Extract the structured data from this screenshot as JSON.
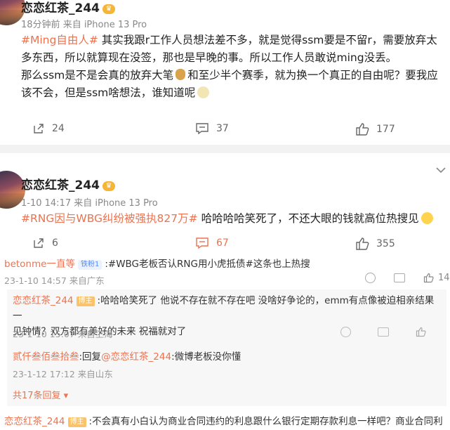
{
  "post1": {
    "username": "恋恋红茶_244",
    "time": "18分钟前",
    "source": "来自 iPhone 13 Pro",
    "topic": "#Ming自由人#",
    "text_line1": " 其实我跟r工作人员想法差不多，就是觉得ssm要是不留r，需要放弃太",
    "text_line2": "多东西，所以就算现在没签，那也是早晚的事。所以工作人员敢说ming没丢。",
    "text_line3a": "那么ssm是不是会真的放弃大笔",
    "text_line3b": "和至少半个赛季，就为换一个真正的自由呢？要我应",
    "text_line4": "该不会，但是ssm啥想法，谁知道呢",
    "share_count": "24",
    "comment_count": "37",
    "like_count": "177"
  },
  "post2": {
    "username": "恋恋红茶_244",
    "time": "1-10 14:17",
    "source": "来自 iPhone 13 Pro",
    "topic": "#RNG因与WBG纠纷被强执827万#",
    "text": " 哈哈哈哈笑死了，不还大眼的钱就高位热搜见",
    "share_count": "6",
    "comment_count": "67",
    "like_count": "355"
  },
  "comment1": {
    "user": "betonme一直等",
    "badge": "铁粉1",
    "text_topic": ":#WBG老板否认RNG用小虎抵债#",
    "text_rest": "这条也上热搜",
    "time": "23-1-10 14:57",
    "location": "来自广东",
    "like_count": "14"
  },
  "reply1": {
    "user": "恋恋红茶_244",
    "badge": "博主",
    "text_line1": ":哈哈哈笑死了 他说不存在就不存在吧 没啥好争论的，emm有点像被迫相亲结果一",
    "text_line2": "见钟情？双方都有美好的未来 祝福就对了",
    "time": "23-1-10 15:07",
    "location": "来自上海"
  },
  "reply2": {
    "user": "贰仟叁佰叁拾叁",
    "reply_label": ":回复",
    "mention": "@恋恋红茶_244",
    "text": ":微博老板没你懂",
    "time": "23-1-12 17:12",
    "location": "来自山东"
  },
  "more_replies": "共17条回复",
  "comment2": {
    "user": "恋恋红茶_244",
    "badge": "博主",
    "text": ":不会真有小白认为商业合同违约的利息跟什么银行定期存款利息一样吧？商业合同利"
  },
  "colors": {
    "accent": "#eb7350",
    "link": "#eb7350",
    "divider": "#f2f2f2"
  },
  "icons": [
    "share-icon",
    "comment-icon",
    "like-icon",
    "chevron-down-icon",
    "vip-icon",
    "moneybag-icon",
    "grin-emoji-icon",
    "heart-eyes-emoji-icon"
  ]
}
